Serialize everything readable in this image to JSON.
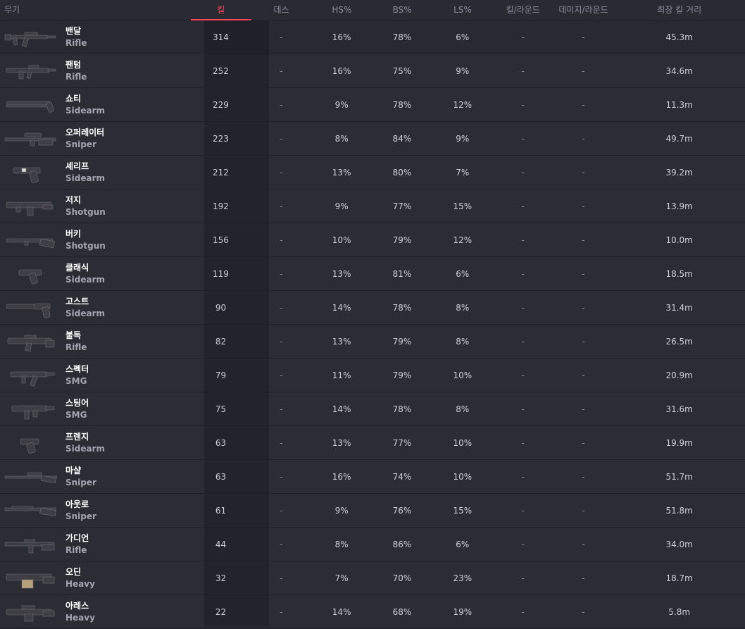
{
  "header": {
    "weapon": "무기",
    "kills": "킬",
    "deaths": "데스",
    "hs": "HS%",
    "bs": "BS%",
    "ls": "LS%",
    "kpr": "킬/라운드",
    "dpr": "데미지/라운드",
    "longest": "최장 킬 거리"
  },
  "colors": {
    "accent": "#ff4655",
    "row_bg": "#2c2c35",
    "sorted_col_bg": "#23232b",
    "text": "#cfcfd6",
    "muted": "#8c8c96"
  },
  "rows": [
    {
      "name": "밴달",
      "type": "Rifle",
      "icon": "vandal-icon",
      "kills": "314",
      "deaths": "-",
      "hs": "16%",
      "bs": "78%",
      "ls": "6%",
      "kpr": "-",
      "dpr": "-",
      "longest": "45.3m"
    },
    {
      "name": "팬텀",
      "type": "Rifle",
      "icon": "phantom-icon",
      "kills": "252",
      "deaths": "-",
      "hs": "16%",
      "bs": "75%",
      "ls": "9%",
      "kpr": "-",
      "dpr": "-",
      "longest": "34.6m"
    },
    {
      "name": "쇼티",
      "type": "Sidearm",
      "icon": "shorty-icon",
      "kills": "229",
      "deaths": "-",
      "hs": "9%",
      "bs": "78%",
      "ls": "12%",
      "kpr": "-",
      "dpr": "-",
      "longest": "11.3m"
    },
    {
      "name": "오퍼레이터",
      "type": "Sniper",
      "icon": "operator-icon",
      "kills": "223",
      "deaths": "-",
      "hs": "8%",
      "bs": "84%",
      "ls": "9%",
      "kpr": "-",
      "dpr": "-",
      "longest": "49.7m"
    },
    {
      "name": "셰리프",
      "type": "Sidearm",
      "icon": "sheriff-icon",
      "kills": "212",
      "deaths": "-",
      "hs": "13%",
      "bs": "80%",
      "ls": "7%",
      "kpr": "-",
      "dpr": "-",
      "longest": "39.2m"
    },
    {
      "name": "저지",
      "type": "Shotgun",
      "icon": "judge-icon",
      "kills": "192",
      "deaths": "-",
      "hs": "9%",
      "bs": "77%",
      "ls": "15%",
      "kpr": "-",
      "dpr": "-",
      "longest": "13.9m"
    },
    {
      "name": "버키",
      "type": "Shotgun",
      "icon": "bucky-icon",
      "kills": "156",
      "deaths": "-",
      "hs": "10%",
      "bs": "79%",
      "ls": "12%",
      "kpr": "-",
      "dpr": "-",
      "longest": "10.0m"
    },
    {
      "name": "클래식",
      "type": "Sidearm",
      "icon": "classic-icon",
      "kills": "119",
      "deaths": "-",
      "hs": "13%",
      "bs": "81%",
      "ls": "6%",
      "kpr": "-",
      "dpr": "-",
      "longest": "18.5m"
    },
    {
      "name": "고스트",
      "type": "Sidearm",
      "icon": "ghost-icon",
      "kills": "90",
      "deaths": "-",
      "hs": "14%",
      "bs": "78%",
      "ls": "8%",
      "kpr": "-",
      "dpr": "-",
      "longest": "31.4m"
    },
    {
      "name": "불독",
      "type": "Rifle",
      "icon": "bulldog-icon",
      "kills": "82",
      "deaths": "-",
      "hs": "13%",
      "bs": "79%",
      "ls": "8%",
      "kpr": "-",
      "dpr": "-",
      "longest": "26.5m"
    },
    {
      "name": "스펙터",
      "type": "SMG",
      "icon": "spectre-icon",
      "kills": "79",
      "deaths": "-",
      "hs": "11%",
      "bs": "79%",
      "ls": "10%",
      "kpr": "-",
      "dpr": "-",
      "longest": "20.9m"
    },
    {
      "name": "스팅어",
      "type": "SMG",
      "icon": "stinger-icon",
      "kills": "75",
      "deaths": "-",
      "hs": "14%",
      "bs": "78%",
      "ls": "8%",
      "kpr": "-",
      "dpr": "-",
      "longest": "31.6m"
    },
    {
      "name": "프렌지",
      "type": "Sidearm",
      "icon": "frenzy-icon",
      "kills": "63",
      "deaths": "-",
      "hs": "13%",
      "bs": "77%",
      "ls": "10%",
      "kpr": "-",
      "dpr": "-",
      "longest": "19.9m"
    },
    {
      "name": "마샬",
      "type": "Sniper",
      "icon": "marshal-icon",
      "kills": "63",
      "deaths": "-",
      "hs": "16%",
      "bs": "74%",
      "ls": "10%",
      "kpr": "-",
      "dpr": "-",
      "longest": "51.7m"
    },
    {
      "name": "아웃로",
      "type": "Sniper",
      "icon": "outlaw-icon",
      "kills": "61",
      "deaths": "-",
      "hs": "9%",
      "bs": "76%",
      "ls": "15%",
      "kpr": "-",
      "dpr": "-",
      "longest": "51.8m"
    },
    {
      "name": "가디언",
      "type": "Rifle",
      "icon": "guardian-icon",
      "kills": "44",
      "deaths": "-",
      "hs": "8%",
      "bs": "86%",
      "ls": "6%",
      "kpr": "-",
      "dpr": "-",
      "longest": "34.0m"
    },
    {
      "name": "오딘",
      "type": "Heavy",
      "icon": "odin-icon",
      "kills": "32",
      "deaths": "-",
      "hs": "7%",
      "bs": "70%",
      "ls": "23%",
      "kpr": "-",
      "dpr": "-",
      "longest": "18.7m"
    },
    {
      "name": "아레스",
      "type": "Heavy",
      "icon": "ares-icon",
      "kills": "22",
      "deaths": "-",
      "hs": "14%",
      "bs": "68%",
      "ls": "19%",
      "kpr": "-",
      "dpr": "-",
      "longest": "5.8m"
    }
  ]
}
